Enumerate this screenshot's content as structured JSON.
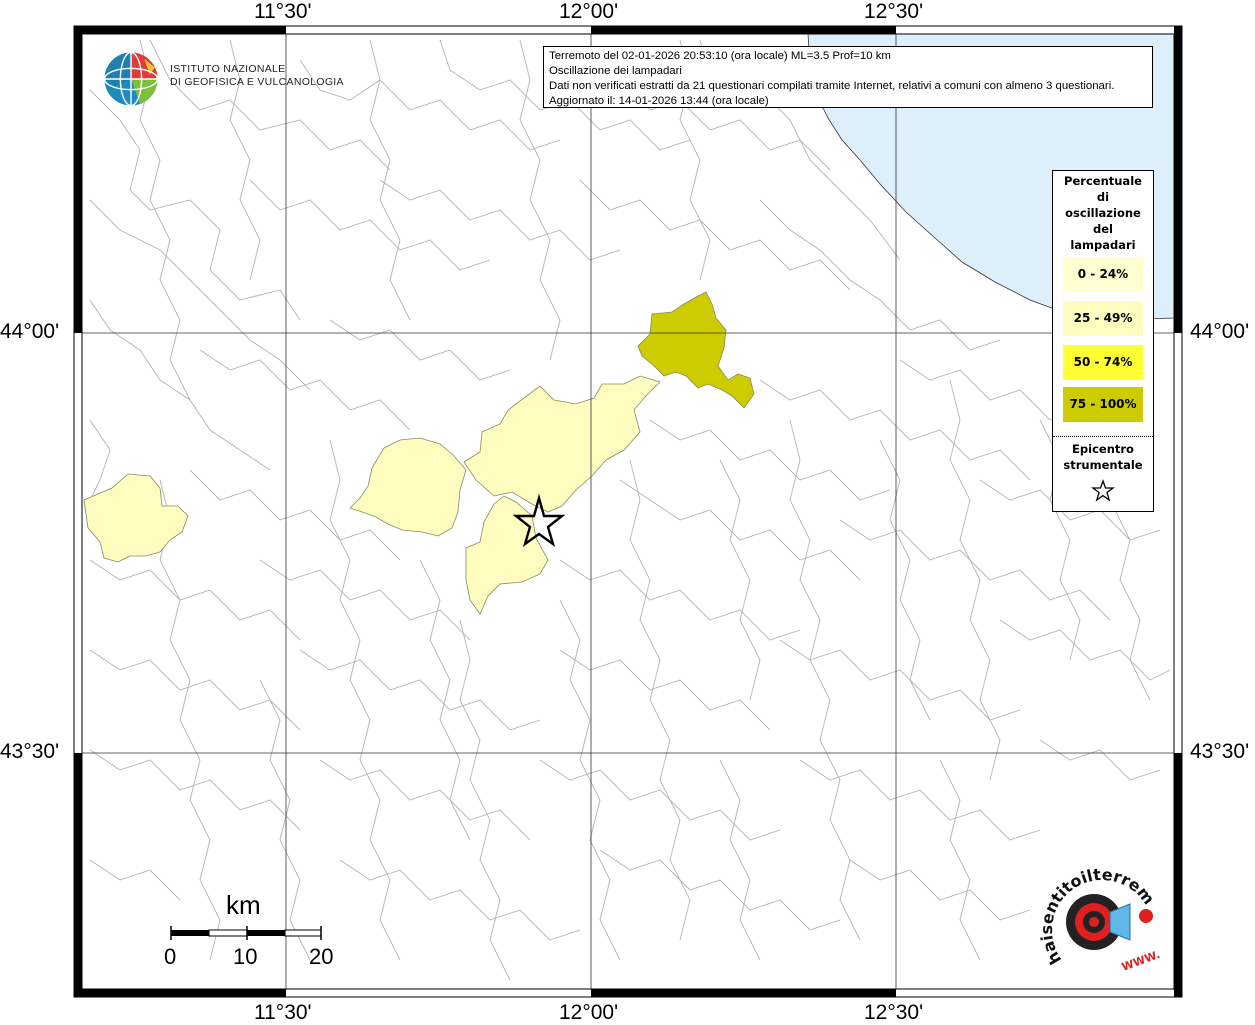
{
  "map": {
    "lon_ticks": [
      "11°30'",
      "12°00'",
      "12°30'"
    ],
    "lat_ticks": [
      "44°00'",
      "43°30'"
    ],
    "colors": {
      "sea": "#ddeffb",
      "border": "#b3b3b3",
      "class_0_24": "#fffed0",
      "class_25_49": "#fffcbf",
      "class_50_74": "#ffff33",
      "class_75_100": "#cccc00"
    },
    "shaded_areas": [
      {
        "name": "west-area",
        "class": "25 - 49%"
      },
      {
        "name": "central-west-area",
        "class": "25 - 49%"
      },
      {
        "name": "central-area",
        "class": "25 - 49%"
      },
      {
        "name": "south-central-area",
        "class": "25 - 49%"
      },
      {
        "name": "northeast-area",
        "class": "75 - 100%"
      }
    ]
  },
  "header": {
    "logo_line1": "ISTITUTO NAZIONALE",
    "logo_line2": "DI GEOFISICA E VULCANOLOGIA"
  },
  "info": {
    "line1": "Terremoto del 02-01-2026 20:53:10 (ora locale) ML=3.5 Prof=10 km",
    "line2": "Oscillazione dei lampadari",
    "line3": "Dati non verificati estratti da 21 questionari compilati tramite Internet, relativi a comuni con almeno 3 questionari.",
    "line4": "Aggiornato il: 14-01-2026 13:44 (ora locale)"
  },
  "legend": {
    "title_lines": [
      "Percentuale",
      "di",
      "oscillazione",
      "del",
      "lampadari"
    ],
    "classes": [
      {
        "label": "0 - 24%",
        "color": "#fffed0"
      },
      {
        "label": "25 - 49%",
        "color": "#fffcbf"
      },
      {
        "label": "50 - 74%",
        "color": "#ffff33"
      },
      {
        "label": "75 - 100%",
        "color": "#cccc00"
      }
    ],
    "epicenter_lines": [
      "Epicentro",
      "strumentale"
    ],
    "epicenter_icon": "star-outline-icon"
  },
  "scalebar": {
    "unit": "km",
    "labels": [
      "0",
      "10",
      "20"
    ]
  },
  "branding": {
    "hsi_text": "haisentitoilterremoto.it",
    "hsi_www": "WWW."
  }
}
